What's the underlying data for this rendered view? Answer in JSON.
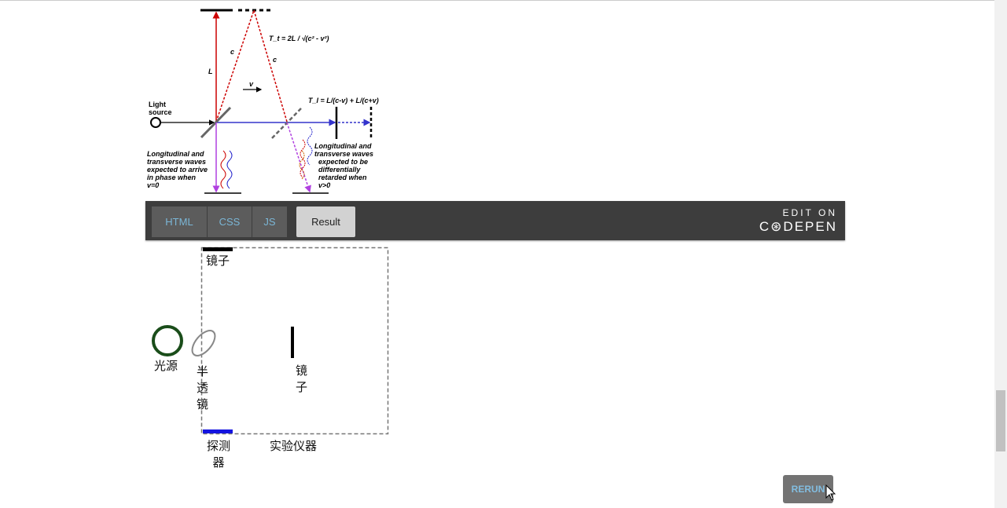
{
  "diagram": {
    "formula_transverse": "T_t = 2L / √(c² - v²)",
    "formula_longitudinal": "T_l = L/(c-v) + L/(c+v)",
    "label_L": "L",
    "label_c": "c",
    "label_v": "v",
    "light_source": [
      "Light",
      "source"
    ],
    "left_caption": [
      "Longitudinal and",
      "transverse waves",
      "expected to arrive",
      "in phase when",
      "v=0"
    ],
    "right_caption": [
      "Longitudinal and",
      "transverse waves",
      "expected to be",
      "differentially",
      "retarded when",
      "v>0"
    ]
  },
  "codepen": {
    "tabs": [
      {
        "label": "HTML"
      },
      {
        "label": "CSS"
      },
      {
        "label": "JS"
      },
      {
        "label": "Result"
      }
    ],
    "active_tab": "Result",
    "edit_on": "EDIT ON",
    "brand": "C⊛DEPEN"
  },
  "result": {
    "mirror_top": "镜子",
    "light_source": "光源",
    "beam_splitter": "半透镜",
    "mirror_right": "镜子",
    "detector": "探测器",
    "apparatus": "实验仪器",
    "colors": {
      "light_source": "#1a4d1a",
      "detector": "#1414e0",
      "mirror": "#000000"
    }
  },
  "rerun_label": "RERUN"
}
